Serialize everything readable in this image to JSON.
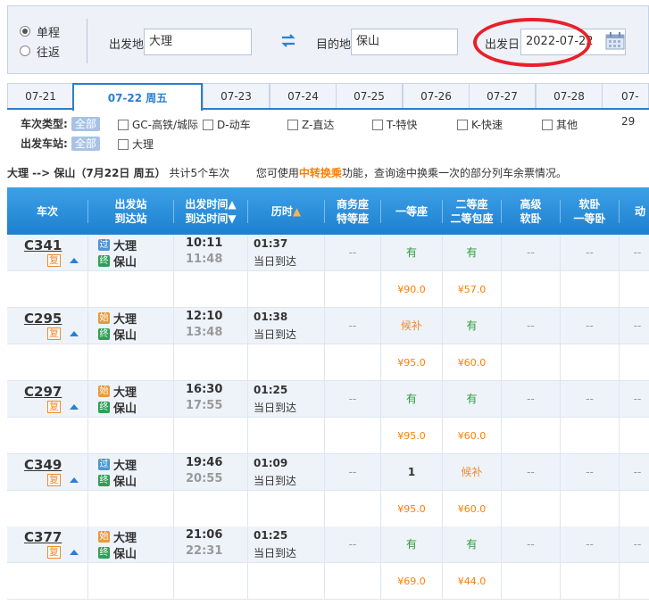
{
  "search": {
    "trip_types": [
      "单程",
      "往返"
    ],
    "selected_trip": "单程",
    "from_label": "出发地",
    "from_value": "大理",
    "to_label": "目的地",
    "to_value": "保山",
    "date_label": "出发日",
    "date_value": "2022-07-22"
  },
  "date_tabs": [
    {
      "label": "07-21"
    },
    {
      "label": "07-22 周五",
      "active": true
    },
    {
      "label": "07-23"
    },
    {
      "label": "07-24"
    },
    {
      "label": "07-25"
    },
    {
      "label": "07-26"
    },
    {
      "label": "07-27"
    },
    {
      "label": "07-28"
    },
    {
      "label": "07-29"
    }
  ],
  "filters": {
    "type_label": "车次类型:",
    "all_label": "全部",
    "types": [
      "GC-高铁/城际",
      "D-动车",
      "Z-直达",
      "T-特快",
      "K-快速",
      "其他"
    ],
    "station_label": "出发车站:",
    "station_all": "全部",
    "stations": [
      "大理"
    ]
  },
  "summary": {
    "route": "大理 --> 保山（7月22日  周五）",
    "count_text": "共计5个车次",
    "tip_prefix": "您可使用",
    "tip_highlight": "中转换乘",
    "tip_suffix": "功能，查询途中换乘一次的部分列车余票情况。"
  },
  "table_header": {
    "train": "车次",
    "station_1": "出发站",
    "station_2": "到达站",
    "time_1": "出发时间",
    "time_2": "到达时间",
    "duration": "历时",
    "business_1": "商务座",
    "business_2": "特等座",
    "first": "一等座",
    "second_1": "二等座",
    "second_2": "二等包座",
    "adv_1": "高级",
    "adv_2": "软卧",
    "soft_1": "软卧",
    "soft_2": "一等卧",
    "moving": "动"
  },
  "icons": {
    "fu": "复",
    "guo": "过",
    "shi": "始",
    "zhong": "终"
  },
  "trains": [
    {
      "code": "C341",
      "from_badge": "过",
      "from": "大理",
      "to_badge": "终",
      "to": "保山",
      "depart": "10:11",
      "arrive": "11:48",
      "duration": "01:37",
      "arrive_day": "当日到达",
      "business": "--",
      "first": "有",
      "second": "有",
      "adv": "--",
      "soft": "--",
      "moving": "--",
      "first_price": "¥90.0",
      "second_price": "¥57.0"
    },
    {
      "code": "C295",
      "from_badge": "始",
      "from": "大理",
      "to_badge": "终",
      "to": "保山",
      "depart": "12:10",
      "arrive": "13:48",
      "duration": "01:38",
      "arrive_day": "当日到达",
      "business": "--",
      "first": "候补",
      "second": "有",
      "adv": "--",
      "soft": "--",
      "moving": "--",
      "first_price": "¥95.0",
      "second_price": "¥60.0"
    },
    {
      "code": "C297",
      "from_badge": "始",
      "from": "大理",
      "to_badge": "终",
      "to": "保山",
      "depart": "16:30",
      "arrive": "17:55",
      "duration": "01:25",
      "arrive_day": "当日到达",
      "business": "--",
      "first": "有",
      "second": "有",
      "adv": "--",
      "soft": "--",
      "moving": "--",
      "first_price": "¥95.0",
      "second_price": "¥60.0"
    },
    {
      "code": "C349",
      "from_badge": "过",
      "from": "大理",
      "to_badge": "终",
      "to": "保山",
      "depart": "19:46",
      "arrive": "20:55",
      "duration": "01:09",
      "arrive_day": "当日到达",
      "business": "--",
      "first": "1",
      "second": "候补",
      "adv": "--",
      "soft": "--",
      "moving": "--",
      "first_price": "¥95.0",
      "second_price": "¥60.0"
    },
    {
      "code": "C377",
      "from_badge": "始",
      "from": "大理",
      "to_badge": "终",
      "to": "保山",
      "depart": "21:06",
      "arrive": "22:31",
      "duration": "01:25",
      "arrive_day": "当日到达",
      "business": "--",
      "first": "有",
      "second": "有",
      "adv": "--",
      "soft": "--",
      "moving": "--",
      "first_price": "¥69.0",
      "second_price": "¥44.0"
    }
  ],
  "colors": {
    "accent": "#2c7ec9",
    "header_blue": "#1d80cf",
    "available_green": "#2c9c35",
    "price_orange": "#ff7f00",
    "annotation_red": "#e8202a"
  }
}
